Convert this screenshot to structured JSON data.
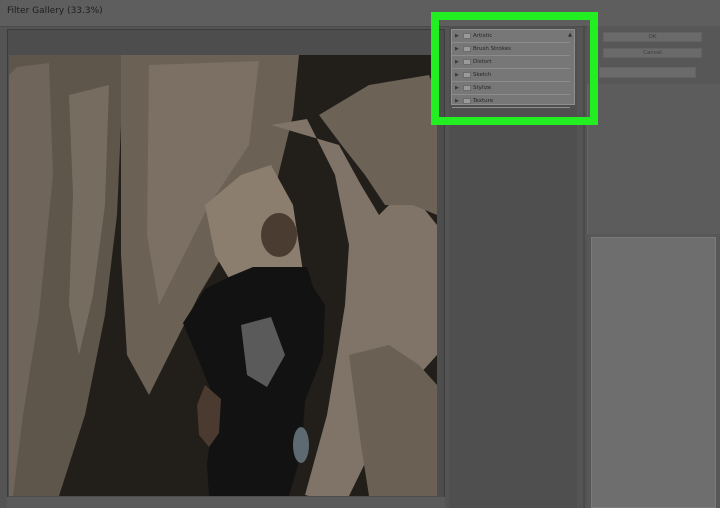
{
  "window": {
    "title": "Filter Gallery (33.3%)"
  },
  "filter_browser": {
    "categories": [
      {
        "label": "Artistic"
      },
      {
        "label": "Brush Strokes"
      },
      {
        "label": "Distort"
      },
      {
        "label": "Sketch"
      },
      {
        "label": "Stylize"
      },
      {
        "label": "Texture"
      }
    ]
  },
  "buttons": {
    "ok": "OK",
    "cancel": "Cancel"
  },
  "colors": {
    "highlight": "#22ee22"
  }
}
